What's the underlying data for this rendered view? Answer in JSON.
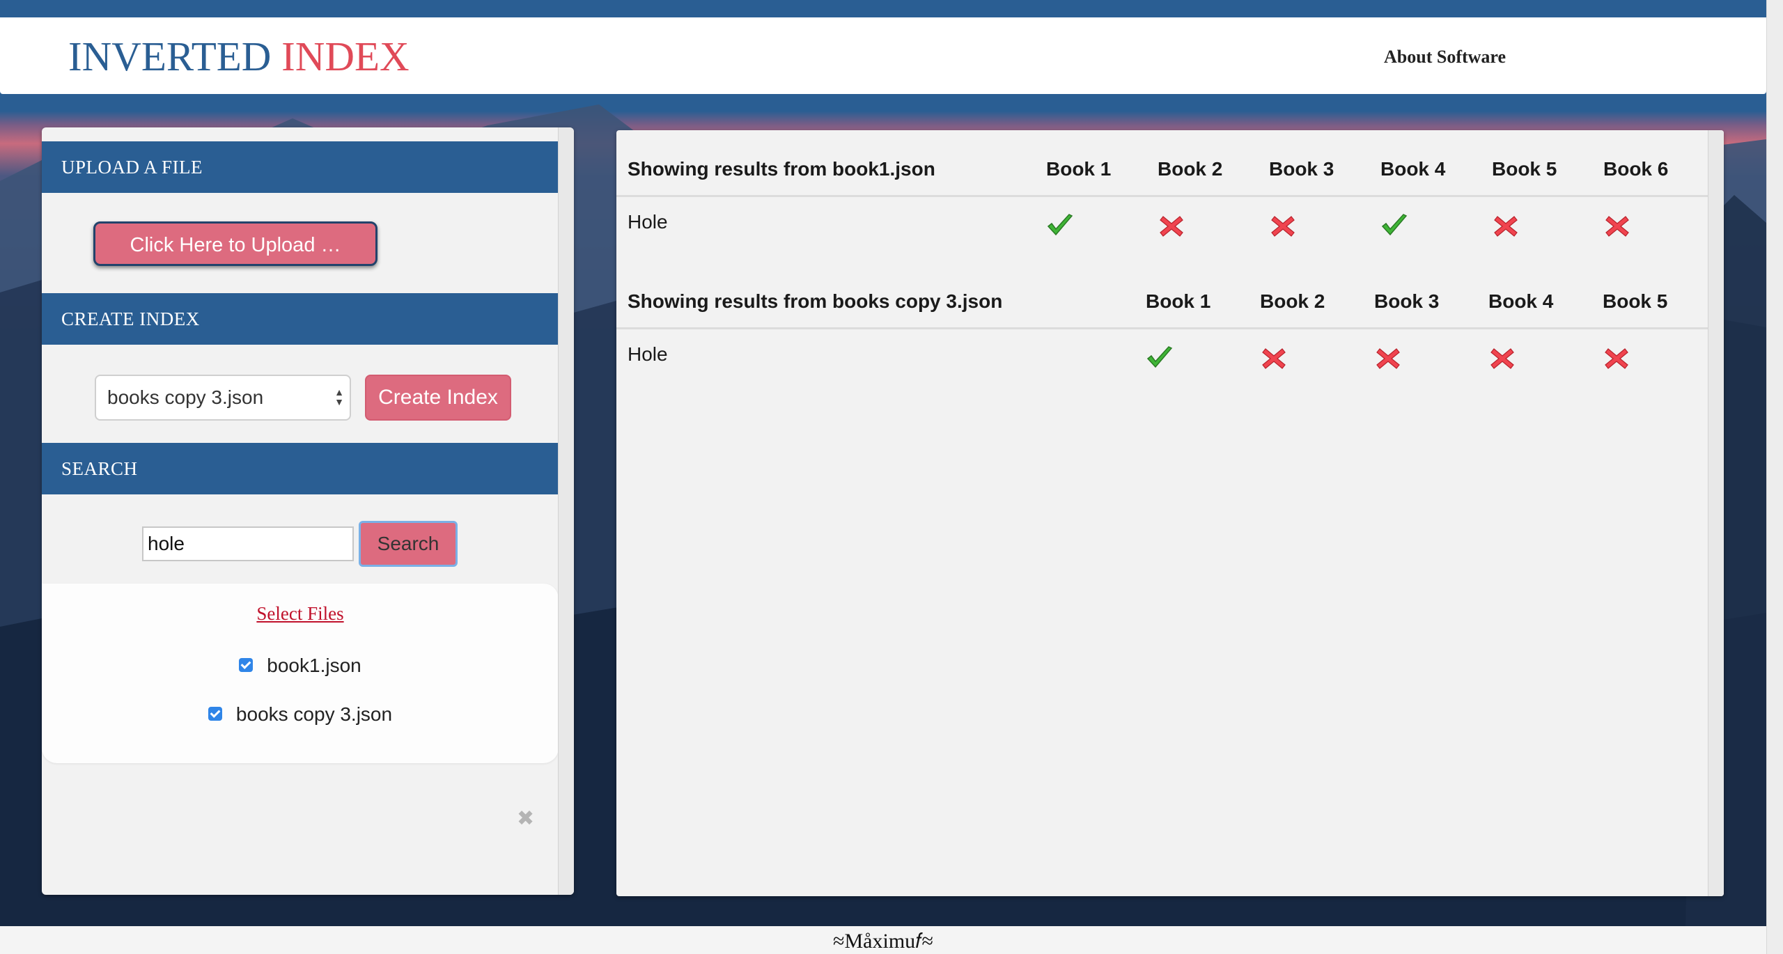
{
  "header": {
    "brand_word1": "INVERTED",
    "brand_word2": "INDEX",
    "about_link": "About Software"
  },
  "sidebar": {
    "upload_section": "UPLOAD A FILE",
    "upload_button": "Click Here to Upload …",
    "create_section": "CREATE INDEX",
    "index_select_value": "books copy 3.json",
    "create_button": "Create Index",
    "search_section": "SEARCH",
    "search_value": "hole",
    "search_button": "Search",
    "select_files_title": "Select Files",
    "files": [
      {
        "name": "book1.json",
        "checked": true
      },
      {
        "name": "books copy 3.json",
        "checked": true
      }
    ],
    "close_glyph": "✖"
  },
  "results": [
    {
      "title": "Showing results from book1.json",
      "columns": [
        "Book 1",
        "Book 2",
        "Book 3",
        "Book 4",
        "Book 5",
        "Book 6"
      ],
      "rows": [
        {
          "word": "Hole",
          "found": [
            true,
            false,
            false,
            true,
            false,
            false
          ]
        }
      ]
    },
    {
      "title": "Showing results from books copy 3.json",
      "columns": [
        "Book 1",
        "Book 2",
        "Book 3",
        "Book 4",
        "Book 5"
      ],
      "rows": [
        {
          "word": "Hole",
          "found": [
            true,
            false,
            false,
            false,
            false
          ]
        }
      ]
    }
  ],
  "footer": {
    "signature": "≈Måximu𝑓≈"
  },
  "colors": {
    "brand_blue": "#2a5e93",
    "brand_red": "#e04a58",
    "button_pink": "#dd6b7f",
    "check_green": "#3fb536",
    "cross_red": "#f0444f"
  }
}
